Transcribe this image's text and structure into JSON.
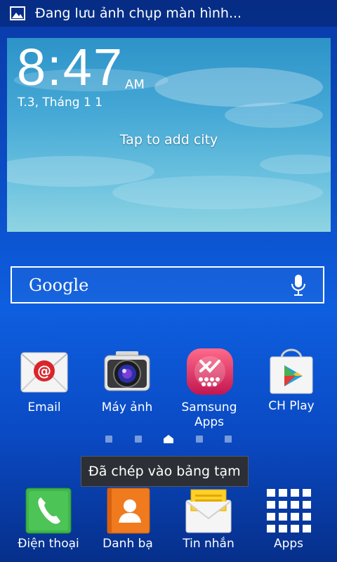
{
  "status_bar": {
    "notification_text": "Đang lưu ảnh chụp màn hình...",
    "icon": "image-icon"
  },
  "weather_widget": {
    "time": "8:47",
    "ampm": "AM",
    "date": "T.3, Tháng 1 1",
    "prompt": "Tap to add city"
  },
  "search_bar": {
    "label": "Google",
    "icon": "microphone-icon"
  },
  "home_apps": [
    {
      "label": "Email",
      "icon": "email-icon"
    },
    {
      "label": "Máy ảnh",
      "icon": "camera-icon"
    },
    {
      "label": "Samsung Apps",
      "icon": "samsung-apps-icon"
    },
    {
      "label": "CH Play",
      "icon": "play-store-icon"
    }
  ],
  "toast": {
    "message": "Đã chép vào bảng tạm"
  },
  "dock": [
    {
      "label": "Điện thoại",
      "icon": "phone-icon"
    },
    {
      "label": "Danh bạ",
      "icon": "contacts-icon"
    },
    {
      "label": "Tin nhắn",
      "icon": "messages-icon"
    },
    {
      "label": "Apps",
      "icon": "apps-grid-icon"
    }
  ],
  "colors": {
    "wallpaper": "#0b4fc9",
    "sky": "#46a9d6",
    "toast_bg": "#2c2f35"
  }
}
